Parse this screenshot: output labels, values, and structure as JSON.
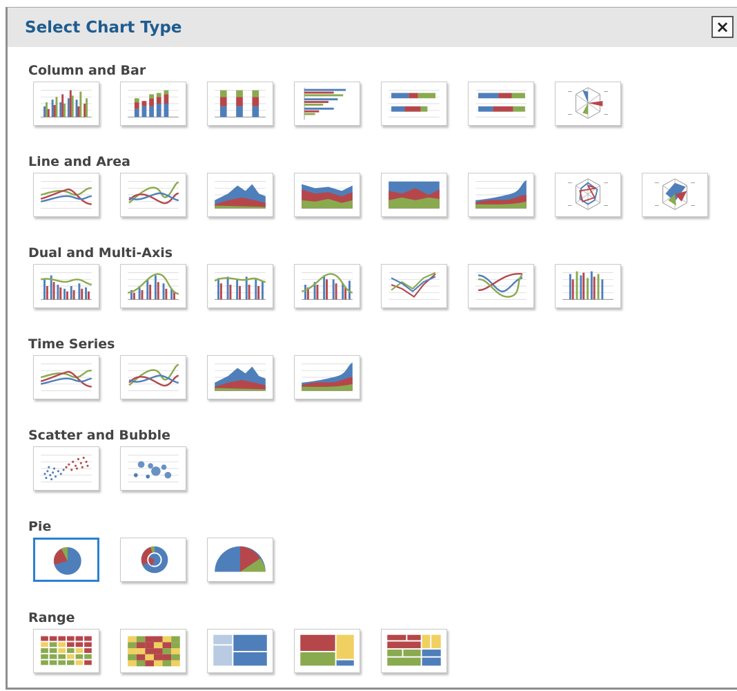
{
  "dialog": {
    "title": "Select Chart Type",
    "close_label": "×"
  },
  "sections": [
    {
      "title": "Column and Bar",
      "thumbnails": [
        "column-clustered",
        "column-stacked",
        "column-stacked-100",
        "bar-clustered",
        "bar-stacked",
        "bar-stacked-100",
        "radar-column"
      ]
    },
    {
      "title": "Line and Area",
      "thumbnails": [
        "line",
        "spline",
        "area",
        "area-stacked",
        "area-stacked-100",
        "area-spline",
        "radar-line",
        "radar-area"
      ]
    },
    {
      "title": "Dual and Multi-Axis",
      "thumbnails": [
        "dual-column-line",
        "dual-column-spline",
        "dual-column-line-2",
        "dual-column-spline-2",
        "multi-axis-line",
        "multi-axis-spline",
        "multi-axis-column"
      ]
    },
    {
      "title": "Time Series",
      "thumbnails": [
        "time-line",
        "time-spline",
        "time-area",
        "time-area-spline"
      ]
    },
    {
      "title": "Scatter and Bubble",
      "thumbnails": [
        "scatter",
        "bubble"
      ]
    },
    {
      "title": "Pie",
      "thumbnails": [
        "pie",
        "donut",
        "semi-pie"
      ],
      "selected_index": 0
    },
    {
      "title": "Range",
      "thumbnails": [
        "heatmap",
        "heatmap-gradient",
        "treemap",
        "treemap-squarified",
        "treemap-nested"
      ]
    }
  ],
  "colors": {
    "blue": "#4f7fba",
    "red": "#b5474b",
    "green": "#8aaa4f",
    "yellow": "#f0d060",
    "title": "#1f5c8f",
    "selected_border": "#2a7fd1"
  }
}
